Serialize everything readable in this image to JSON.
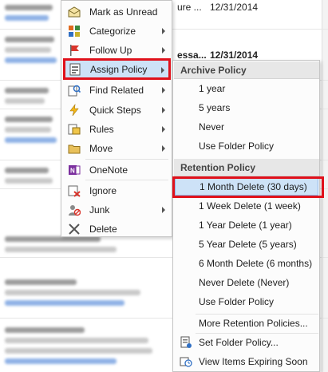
{
  "background": {
    "email_fragments": [
      {
        "text": "ure ...",
        "bold": false
      },
      {
        "text": "12/31/2014",
        "bold": false
      },
      {
        "text": "essa...",
        "bold": true
      },
      {
        "text": "12/31/2014",
        "bold": true
      }
    ]
  },
  "context_menu": {
    "items": [
      {
        "label": "Mark as Unread",
        "icon": "envelope-open-icon",
        "arrow": false
      },
      {
        "label": "Categorize",
        "icon": "categorize-grid-icon",
        "arrow": true
      },
      {
        "label": "Follow Up",
        "icon": "flag-icon",
        "arrow": true
      },
      {
        "label": "Assign Policy",
        "icon": "policy-icon",
        "arrow": true,
        "active": true
      },
      {
        "label": "Find Related",
        "icon": "find-related-icon",
        "arrow": true
      },
      {
        "label": "Quick Steps",
        "icon": "lightning-icon",
        "arrow": true
      },
      {
        "label": "Rules",
        "icon": "rules-icon",
        "arrow": true
      },
      {
        "label": "Move",
        "icon": "folder-move-icon",
        "arrow": true
      },
      {
        "label": "OneNote",
        "icon": "onenote-icon",
        "arrow": false
      },
      {
        "label": "Ignore",
        "icon": "ignore-icon",
        "arrow": false
      },
      {
        "label": "Junk",
        "icon": "junk-icon",
        "arrow": true
      },
      {
        "label": "Delete",
        "icon": "delete-x-icon",
        "arrow": false
      }
    ]
  },
  "submenu": {
    "archive_header": "Archive Policy",
    "archive_items": [
      "1 year",
      "5 years",
      "Never",
      "Use Folder Policy"
    ],
    "retention_header": "Retention Policy",
    "retention_items": [
      "1 Month Delete (30 days)",
      "1 Week Delete (1 week)",
      "1 Year Delete (1 year)",
      "5 Year Delete (5 years)",
      "6 Month Delete (6 months)",
      "Never Delete (Never)",
      "Use Folder Policy"
    ],
    "more_retention": "More Retention Policies...",
    "set_folder_policy": "Set Folder Policy...",
    "view_expiring": "View Items Expiring Soon",
    "active_item": "1 Month Delete (30 days)"
  },
  "colors": {
    "highlight_red": "#e0111b",
    "hover_blue": "#cde2f7",
    "header_gray": "#e7e7e7"
  }
}
